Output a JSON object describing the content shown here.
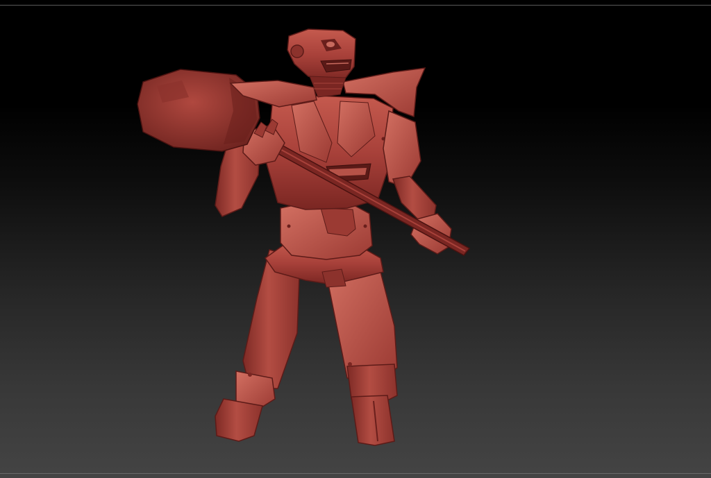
{
  "app": {
    "view": "sculpt-viewport",
    "background": "gradient"
  },
  "colors": {
    "clay_base": "#a8413a",
    "clay_highlight": "#d06a5c",
    "clay_shadow": "#6a1f1c",
    "clay_dark": "#4a1210",
    "frame_line": "#5a5a5a",
    "background_top": "#000000",
    "background_bottom": "#444444"
  },
  "model": {
    "subject": "robot-warrior-with-hammer",
    "material": "red-clay"
  }
}
